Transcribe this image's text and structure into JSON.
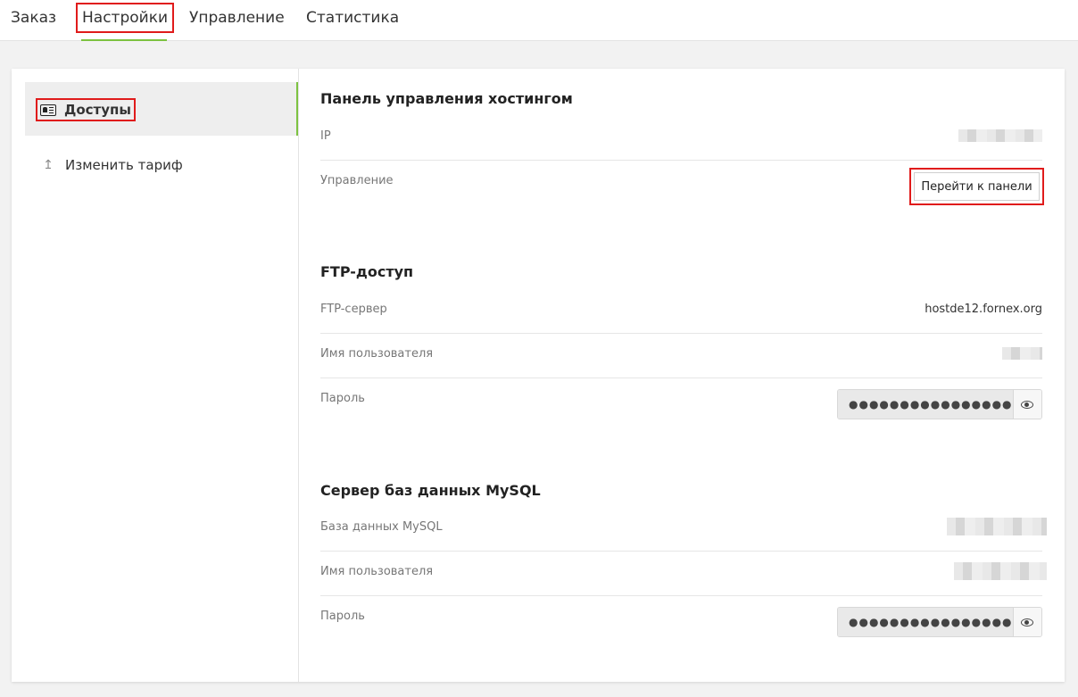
{
  "tabs": [
    {
      "label": "Заказ"
    },
    {
      "label": "Настройки"
    },
    {
      "label": "Управление"
    },
    {
      "label": "Статистика"
    }
  ],
  "active_tab": "Настройки",
  "sidebar": {
    "items": [
      {
        "label": "Доступы",
        "icon": "id-card-icon"
      },
      {
        "label": "Изменить тариф",
        "icon": "arrow-up-icon"
      }
    ]
  },
  "hosting_panel": {
    "title": "Панель управления хостингом",
    "ip_label": "IP",
    "manage_label": "Управление",
    "go_button": "Перейти к панели"
  },
  "ftp": {
    "title": "FTP-доступ",
    "server_label": "FTP-сервер",
    "server_value": "hostde12.fornex.org",
    "user_label": "Имя пользователя",
    "password_label": "Пароль",
    "password_mask": "●●●●●●●●●●●●●●●●"
  },
  "mysql": {
    "title": "Сервер баз данных MySQL",
    "db_label": "База данных MySQL",
    "user_label": "Имя пользователя",
    "password_label": "Пароль",
    "password_mask": "●●●●●●●●●●●●●●●●"
  },
  "colors": {
    "accent_green": "#7dc241",
    "highlight_red": "#e01b1b"
  }
}
